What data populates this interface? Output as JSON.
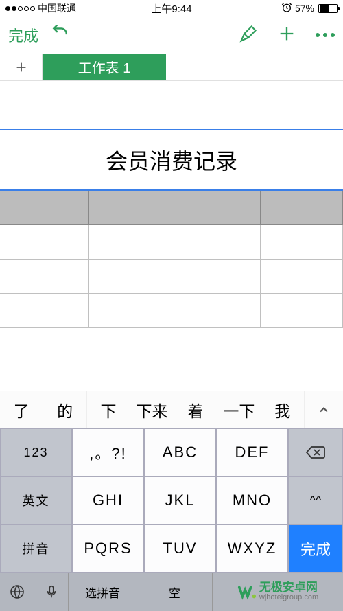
{
  "status": {
    "carrier": "中国联通",
    "time": "上午9:44",
    "battery_pct": "57%"
  },
  "toolbar": {
    "done": "完成"
  },
  "tabs": {
    "sheet1": "工作表 1"
  },
  "sheet": {
    "title": "会员消费记录"
  },
  "candidates": [
    "了",
    "的",
    "下",
    "下来",
    "着",
    "一下",
    "我"
  ],
  "keyboard": {
    "rows": [
      [
        "123",
        ",。?!",
        "ABC",
        "DEF"
      ],
      [
        "英文",
        "GHI",
        "JKL",
        "MNO"
      ],
      [
        "拼音",
        "PQRS",
        "TUV",
        "WXYZ"
      ]
    ],
    "side": {
      "backspace": "⌫",
      "up": "^^",
      "done": "完成"
    },
    "bottom": {
      "select": "选拼音",
      "space": "空"
    },
    "watermark": {
      "name": "无极安卓网",
      "url": "wjhotelgroup.com"
    }
  }
}
